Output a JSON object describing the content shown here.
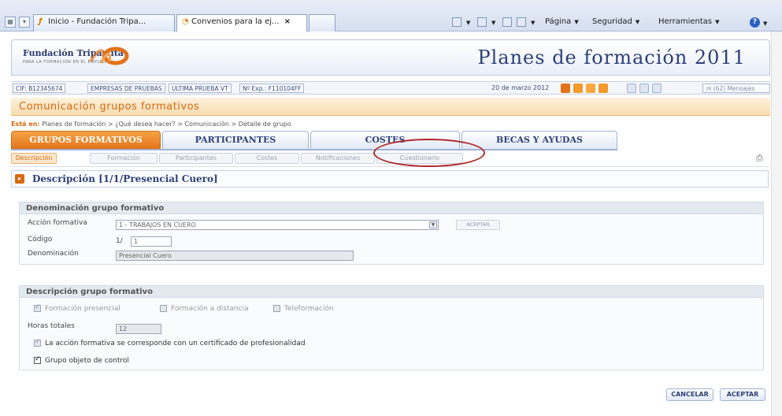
{
  "browser": {
    "tabs": [
      {
        "label": "Inicio - Fundación Tripa..."
      },
      {
        "label": "Convenios para la ej...",
        "close": "×"
      }
    ],
    "commands": {
      "page": "Página",
      "security": "Seguridad",
      "tools": "Herramientas"
    }
  },
  "header": {
    "logo_name": "Fundación Tripartita",
    "logo_tagline": "PARA LA FORMACIÓN EN EL EMPLEO",
    "title": "Planes de formación 2011"
  },
  "info_bar": {
    "chips": [
      "CIF: B12345674",
      "EMPRESAS DE PRUEBAS",
      "ULTIMA PRUEBA VT",
      "Nº Exp.: F110104FF"
    ],
    "date": "20 de marzo 2012",
    "messages": "(62) Mensajes"
  },
  "section": {
    "title": "Comunicación grupos formativos"
  },
  "breadcrumb": {
    "prefix": "Está en:",
    "path": "Planes de formación > ¿Qué desea hacer? > Comunicación > Detalle de grupo"
  },
  "main_tabs": [
    "GRUPOS FORMATIVOS",
    "PARTICIPANTES",
    "COSTES",
    "BECAS Y AYUDAS"
  ],
  "sub_tabs": [
    "Descripción",
    "Formación",
    "Participantes",
    "Costes",
    "Notificaciones",
    "Cuestionario"
  ],
  "panel": {
    "title": "Descripción [1/1/Presencial Cuero]"
  },
  "denominacion": {
    "heading": "Denominación grupo formativo",
    "accion_label": "Acción formativa",
    "accion_value": "1 - TRABAJOS EN CUERO",
    "accept_label": "ACEPTAR",
    "codigo_label": "Código",
    "codigo_prefix": "1/",
    "codigo_value": "1",
    "denominacion_label": "Denominación",
    "denominacion_value": "Presencial Cuero"
  },
  "descripcion": {
    "heading": "Descripción grupo formativo",
    "modalidades": [
      "Formación presencial",
      "Formación a distancia",
      "Teleformación"
    ],
    "horas_label": "Horas totales",
    "horas_value": "12",
    "certificado_label": "La acción formativa se corresponde con un certificado de profesionalidad",
    "control_label": "Grupo objeto de control"
  },
  "actions": {
    "cancel": "CANCELAR",
    "accept": "ACEPTAR"
  },
  "colors": {
    "accent": "#e2731a",
    "brand": "#2d3f78",
    "callout": "#b0262a"
  }
}
